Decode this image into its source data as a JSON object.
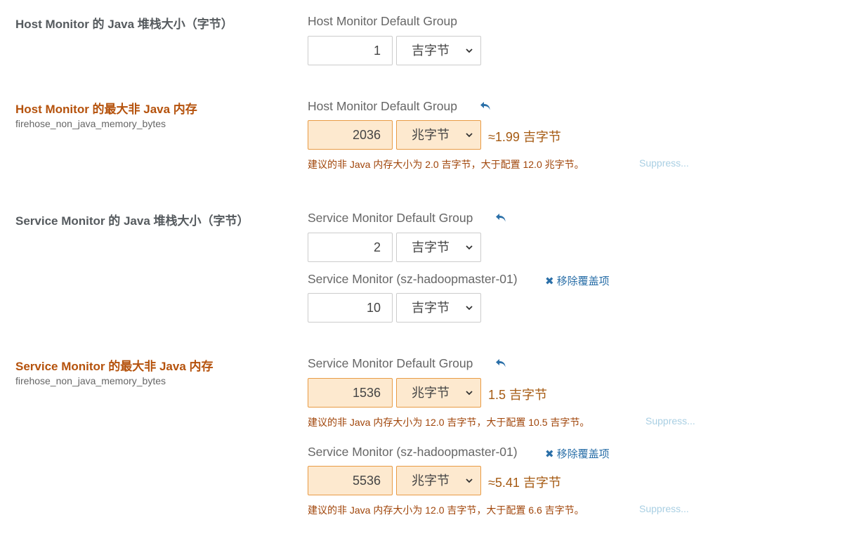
{
  "rows": [
    {
      "title": "Host Monitor 的 Java 堆栈大小（字节）",
      "group_label": "Host Monitor Default Group",
      "value": "1",
      "unit": "吉字节"
    },
    {
      "title": "Host Monitor 的最大非 Java 内存",
      "key": "firehose_non_java_memory_bytes",
      "group_label": "Host Monitor Default Group",
      "value": "2036",
      "unit": "兆字节",
      "approx": "≈1.99 吉字节",
      "advice": "建议的非 Java 内存大小为 2.0 吉字节，大于配置 12.0 兆字节。",
      "suppress": "Suppress..."
    },
    {
      "title": "Service Monitor 的 Java 堆栈大小（字节）",
      "group_label": "Service Monitor Default Group",
      "value": "2",
      "unit": "吉字节",
      "override_label": "Service Monitor (sz-hadoopmaster-01)",
      "remove_label": "移除覆盖项",
      "override_value": "10",
      "override_unit": "吉字节"
    },
    {
      "title": "Service Monitor 的最大非 Java 内存",
      "key": "firehose_non_java_memory_bytes",
      "group_label": "Service Monitor Default Group",
      "value": "1536",
      "unit": "兆字节",
      "approx": "1.5 吉字节",
      "advice": "建议的非 Java 内存大小为 12.0 吉字节，大于配置 10.5 吉字节。",
      "suppress": "Suppress...",
      "override_label": "Service Monitor (sz-hadoopmaster-01)",
      "remove_label": "移除覆盖项",
      "override_value": "5536",
      "override_unit": "兆字节",
      "override_approx": "≈5.41 吉字节",
      "override_advice": "建议的非 Java 内存大小为 12.0 吉字节，大于配置 6.6 吉字节。",
      "override_suppress": "Suppress..."
    }
  ],
  "colors": {
    "warning_text": "#b5520c",
    "warning_fill": "#fde9cf",
    "warning_border": "#e89b45",
    "link": "#2a6fa8",
    "suppress": "#a9cfe3"
  },
  "icons": {
    "undo": "undo-arrow-icon",
    "remove": "close-x-icon",
    "dropdown": "chevron-down-icon"
  }
}
